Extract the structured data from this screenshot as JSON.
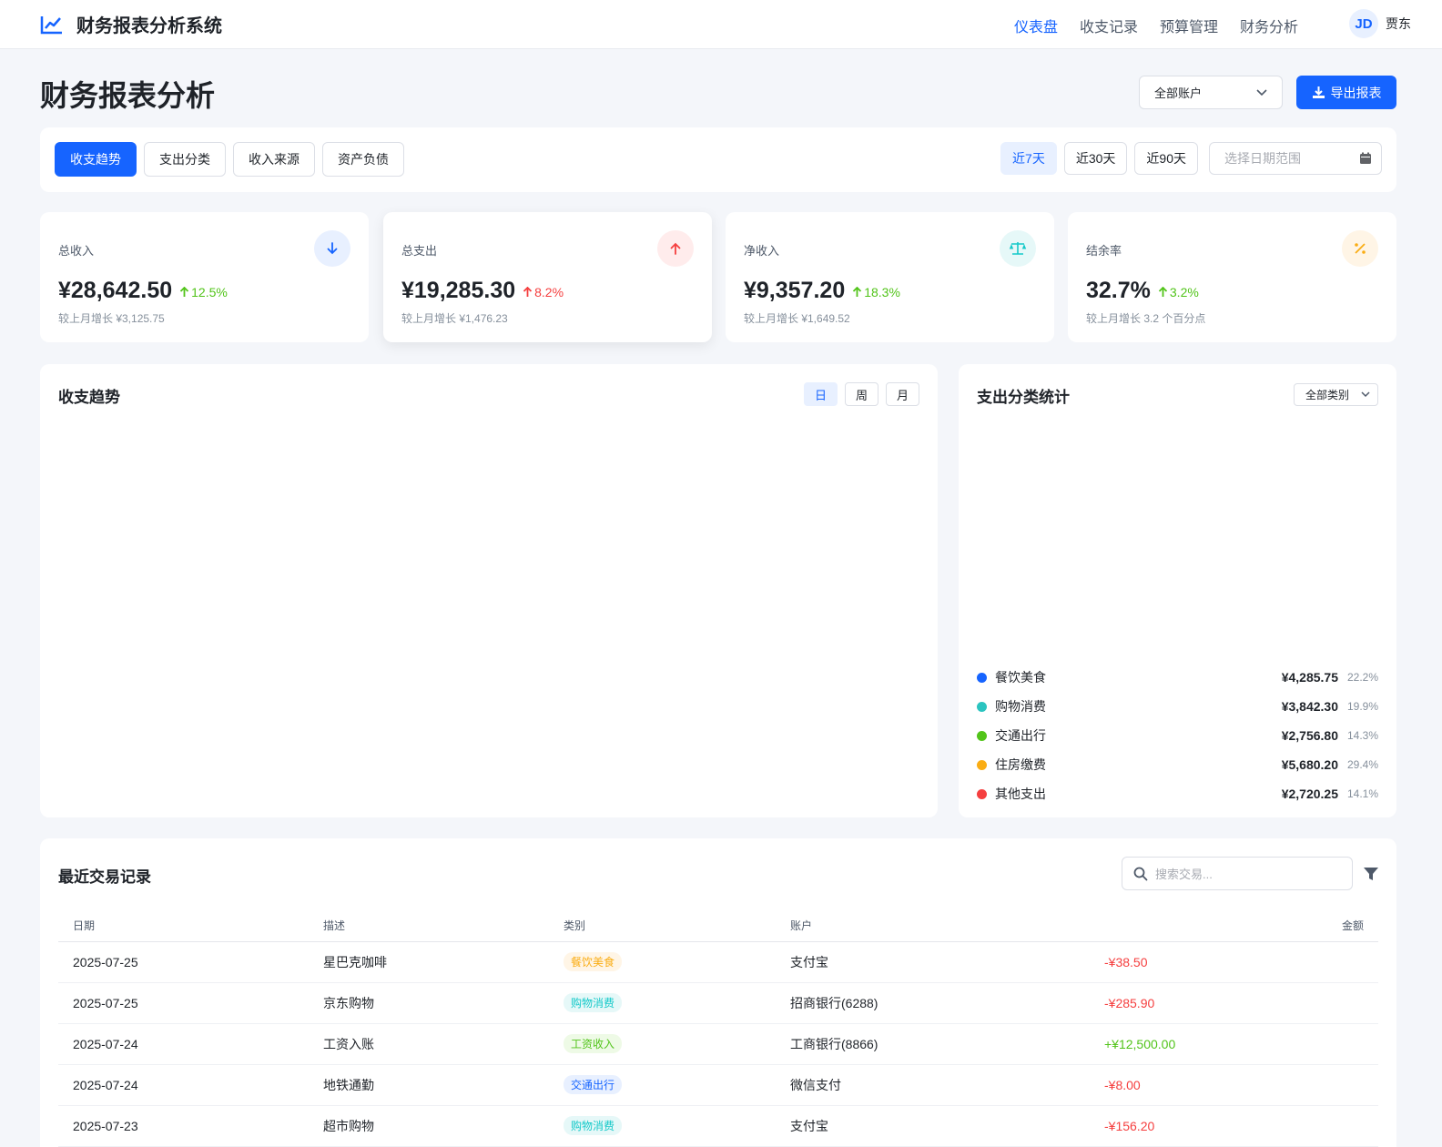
{
  "header": {
    "app_title": "财务报表分析系统",
    "nav": [
      {
        "label": "仪表盘",
        "active": true
      },
      {
        "label": "收支记录",
        "active": false
      },
      {
        "label": "预算管理",
        "active": false
      },
      {
        "label": "财务分析",
        "active": false
      }
    ],
    "user": {
      "initials": "JD",
      "name": "贾东"
    }
  },
  "page": {
    "title": "财务报表分析",
    "account_select": "全部账户",
    "export_label": "导出报表"
  },
  "filters": {
    "tabs": [
      {
        "label": "收支趋势",
        "active": true
      },
      {
        "label": "支出分类",
        "active": false
      },
      {
        "label": "收入来源",
        "active": false
      },
      {
        "label": "资产负债",
        "active": false
      }
    ],
    "ranges": [
      {
        "label": "近7天",
        "active": true
      },
      {
        "label": "近30天",
        "active": false
      },
      {
        "label": "近90天",
        "active": false
      }
    ],
    "date_placeholder": "选择日期范围"
  },
  "stats": [
    {
      "label": "总收入",
      "value": "¥28,642.50",
      "change": "12.5%",
      "sub": "较上月增长 ¥3,125.75",
      "icon": "arrow-down-icon",
      "icon_color": "#1664ff",
      "icon_bg": "#e8f0ff",
      "change_color": "#52c41a"
    },
    {
      "label": "总支出",
      "value": "¥19,285.30",
      "change": "8.2%",
      "sub": "较上月增长 ¥1,476.23",
      "icon": "arrow-up-icon",
      "icon_color": "#f53f3f",
      "icon_bg": "#ffecec",
      "change_color": "#f53f3f"
    },
    {
      "label": "净收入",
      "value": "¥9,357.20",
      "change": "18.3%",
      "sub": "较上月增长 ¥1,649.52",
      "icon": "balance-scale-icon",
      "icon_color": "#14c9c9",
      "icon_bg": "#e6f8f8",
      "change_color": "#52c41a"
    },
    {
      "label": "结余率",
      "value": "32.7%",
      "change": "3.2%",
      "sub": "较上月增长 3.2 个百分点",
      "icon": "percent-icon",
      "icon_color": "#faad14",
      "icon_bg": "#fff5e6",
      "change_color": "#52c41a"
    }
  ],
  "trend_panel": {
    "title": "收支趋势",
    "periods": [
      {
        "label": "日",
        "active": true
      },
      {
        "label": "周",
        "active": false
      },
      {
        "label": "月",
        "active": false
      }
    ]
  },
  "category_panel": {
    "title": "支出分类统计",
    "select": "全部类别",
    "items": [
      {
        "name": "餐饮美食",
        "amount": "¥4,285.75",
        "pct": "22.2%",
        "color": "#1664ff"
      },
      {
        "name": "购物消费",
        "amount": "¥3,842.30",
        "pct": "19.9%",
        "color": "#2bc4c0"
      },
      {
        "name": "交通出行",
        "amount": "¥2,756.80",
        "pct": "14.3%",
        "color": "#52c41a"
      },
      {
        "name": "住房缴费",
        "amount": "¥5,680.20",
        "pct": "29.4%",
        "color": "#faad14"
      },
      {
        "name": "其他支出",
        "amount": "¥2,720.25",
        "pct": "14.1%",
        "color": "#f53f3f"
      }
    ]
  },
  "transactions": {
    "title": "最近交易记录",
    "search_placeholder": "搜索交易...",
    "columns": [
      "日期",
      "描述",
      "类别",
      "账户",
      "",
      "金额"
    ],
    "rows": [
      {
        "date": "2025-07-25",
        "desc": "星巴克咖啡",
        "category": "餐饮美食",
        "cat_color": "#faad14",
        "cat_bg": "#fff5e6",
        "account": "支付宝",
        "amount": "-¥38.50",
        "amount_color": "#f53f3f"
      },
      {
        "date": "2025-07-25",
        "desc": "京东购物",
        "category": "购物消费",
        "cat_color": "#14c9c9",
        "cat_bg": "#e6f8f8",
        "account": "招商银行(6288)",
        "amount": "-¥285.90",
        "amount_color": "#f53f3f"
      },
      {
        "date": "2025-07-24",
        "desc": "工资入账",
        "category": "工资收入",
        "cat_color": "#52c41a",
        "cat_bg": "#eefae6",
        "account": "工商银行(8866)",
        "amount": "+¥12,500.00",
        "amount_color": "#52c41a"
      },
      {
        "date": "2025-07-24",
        "desc": "地铁通勤",
        "category": "交通出行",
        "cat_color": "#1664ff",
        "cat_bg": "#e8f0ff",
        "account": "微信支付",
        "amount": "-¥8.00",
        "amount_color": "#f53f3f"
      },
      {
        "date": "2025-07-23",
        "desc": "超市购物",
        "category": "购物消费",
        "cat_color": "#14c9c9",
        "cat_bg": "#e6f8f8",
        "account": "支付宝",
        "amount": "-¥156.20",
        "amount_color": "#f53f3f"
      }
    ]
  }
}
